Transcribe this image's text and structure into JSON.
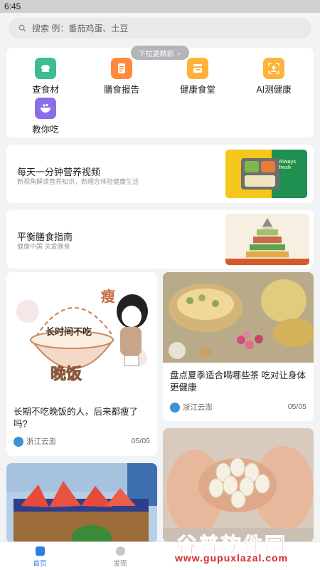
{
  "status": {
    "time": "6:45"
  },
  "search": {
    "placeholder": "搜索 例：番茄鸡蛋、土豆"
  },
  "pull_hint": "下拉更精彩",
  "categories": [
    {
      "label": "查食材",
      "icon": "food-search-icon",
      "color": "#3dbd8f"
    },
    {
      "label": "膳食报告",
      "icon": "report-icon",
      "color": "#ff8a3d"
    },
    {
      "label": "健康食堂",
      "icon": "canteen-icon",
      "color": "#ffb33a"
    },
    {
      "label": "AI测健康",
      "icon": "ai-scan-icon",
      "color": "#ffb33a"
    },
    {
      "label": "教你吃",
      "icon": "bowl-icon",
      "color": "#8a6ee8"
    }
  ],
  "banners": [
    {
      "title": "每天一分钟营养视频",
      "subtitle": "新视角解读营养知识，新理念体验健康生活",
      "image_text": "Always fresh"
    },
    {
      "title": "平衡膳食指南",
      "subtitle": "健康中国 关爱膳食"
    }
  ],
  "feed": [
    {
      "title": "长期不吃晚饭的人，后来都瘦了吗?",
      "author": "浙江云澎",
      "date": "05/05",
      "img_text1": "长时间不吃",
      "img_text2": "晚饭",
      "img_text3": "瘦"
    },
    {
      "title": "盘点夏季适合喝哪些茶 吃对让身体更健康",
      "author": "浙江云澎",
      "date": "05/05"
    },
    {
      "title": ""
    },
    {
      "title": ""
    }
  ],
  "tabs": [
    {
      "label": "首页",
      "active": true
    },
    {
      "label": "发现",
      "active": false
    }
  ],
  "watermark": {
    "name": "谷普软件园",
    "url": "www.gupuxlazal.com"
  }
}
